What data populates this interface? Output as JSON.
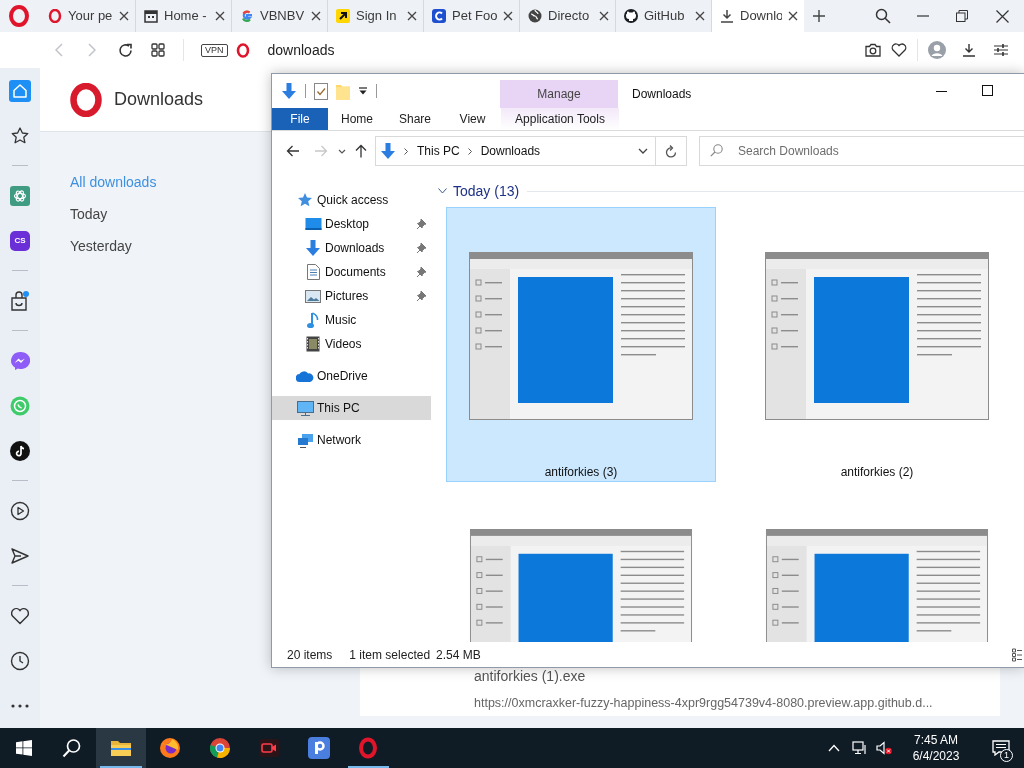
{
  "browser": {
    "tabs": [
      {
        "title": "Your pe",
        "selected": false
      },
      {
        "title": "Home -",
        "selected": false
      },
      {
        "title": "VBNBV",
        "selected": false
      },
      {
        "title": "Sign In",
        "selected": false
      },
      {
        "title": "Pet Foo",
        "selected": false
      },
      {
        "title": "Directo",
        "selected": false
      },
      {
        "title": "GitHub",
        "selected": false
      },
      {
        "title": "Downlo",
        "selected": true
      }
    ],
    "address_bar": {
      "vpn_badge": "VPN",
      "url": "downloads"
    }
  },
  "sidebar": {
    "items": [
      {
        "kind": "home",
        "selected": true
      },
      {
        "kind": "star",
        "selected": false
      },
      {
        "kind": "divider"
      },
      {
        "kind": "chat",
        "selected": false
      },
      {
        "kind": "cs",
        "label": "CS",
        "selected": false
      },
      {
        "kind": "divider"
      },
      {
        "kind": "bag",
        "selected": false
      },
      {
        "kind": "divider"
      },
      {
        "kind": "messenger",
        "selected": false
      },
      {
        "kind": "whatsapp",
        "selected": false
      },
      {
        "kind": "tiktok",
        "selected": false
      },
      {
        "kind": "divider"
      },
      {
        "kind": "play",
        "selected": false
      },
      {
        "kind": "send",
        "selected": false
      },
      {
        "kind": "divider"
      },
      {
        "kind": "heart",
        "selected": false
      },
      {
        "kind": "clock",
        "selected": false
      },
      {
        "kind": "more",
        "selected": false
      }
    ]
  },
  "downloads_page": {
    "title": "Downloads",
    "nav": [
      {
        "label": "All downloads",
        "selected": true
      },
      {
        "label": "Today",
        "selected": false
      },
      {
        "label": "Yesterday",
        "selected": false
      }
    ],
    "download_item": {
      "filename": "antiforkies (1).exe",
      "url": "https://0xmcraxker-fuzzy-happiness-4xpr9rgg54739v4-8080.preview.app.github.d..."
    }
  },
  "explorer": {
    "title": "Downloads",
    "contextual_group": "Manage",
    "ribbon_tabs": [
      {
        "label": "File",
        "kind": "file"
      },
      {
        "label": "Home",
        "kind": "tab"
      },
      {
        "label": "Share",
        "kind": "tab"
      },
      {
        "label": "View",
        "kind": "tab"
      },
      {
        "label": "Application Tools",
        "kind": "contextual"
      }
    ],
    "breadcrumb": [
      "This PC",
      "Downloads"
    ],
    "search": {
      "placeholder": "Search Downloads"
    },
    "nav_pane": [
      {
        "label": "Quick access",
        "kind": "star",
        "selected": false,
        "children": [
          {
            "label": "Desktop",
            "kind": "desktop",
            "pinned": true,
            "selected": false
          },
          {
            "label": "Downloads",
            "kind": "download",
            "pinned": true,
            "selected": false
          },
          {
            "label": "Documents",
            "kind": "document",
            "pinned": true,
            "selected": false
          },
          {
            "label": "Pictures",
            "kind": "picture",
            "pinned": true,
            "selected": false
          },
          {
            "label": "Music",
            "kind": "music",
            "pinned": false,
            "selected": false
          },
          {
            "label": "Videos",
            "kind": "video",
            "pinned": false,
            "selected": false
          }
        ]
      },
      {
        "label": "OneDrive",
        "kind": "cloud",
        "selected": false
      },
      {
        "label": "This PC",
        "kind": "pc",
        "selected": true
      },
      {
        "label": "Network",
        "kind": "network",
        "selected": false
      }
    ],
    "group": {
      "label": "Today (13)",
      "expanded": true
    },
    "files": [
      {
        "name": "antiforkies (3)",
        "selected": true
      },
      {
        "name": "antiforkies (2)",
        "selected": false
      },
      {
        "selected": false
      },
      {
        "selected": false
      }
    ],
    "status_bar": {
      "item_count": "20 items",
      "selection": "1 item selected",
      "size": "2.54 MB"
    }
  },
  "taskbar": {
    "apps": [
      {
        "kind": "explorer",
        "selected": true,
        "running": true
      },
      {
        "kind": "firefox",
        "selected": false,
        "running": false
      },
      {
        "kind": "chrome",
        "selected": false,
        "running": false
      },
      {
        "kind": "camera",
        "selected": false,
        "running": false
      },
      {
        "kind": "pad",
        "selected": false,
        "running": false
      },
      {
        "kind": "opera",
        "selected": false,
        "running": true
      }
    ],
    "time": "7:45 AM",
    "date": "6/4/2023",
    "notification_count": "1"
  }
}
